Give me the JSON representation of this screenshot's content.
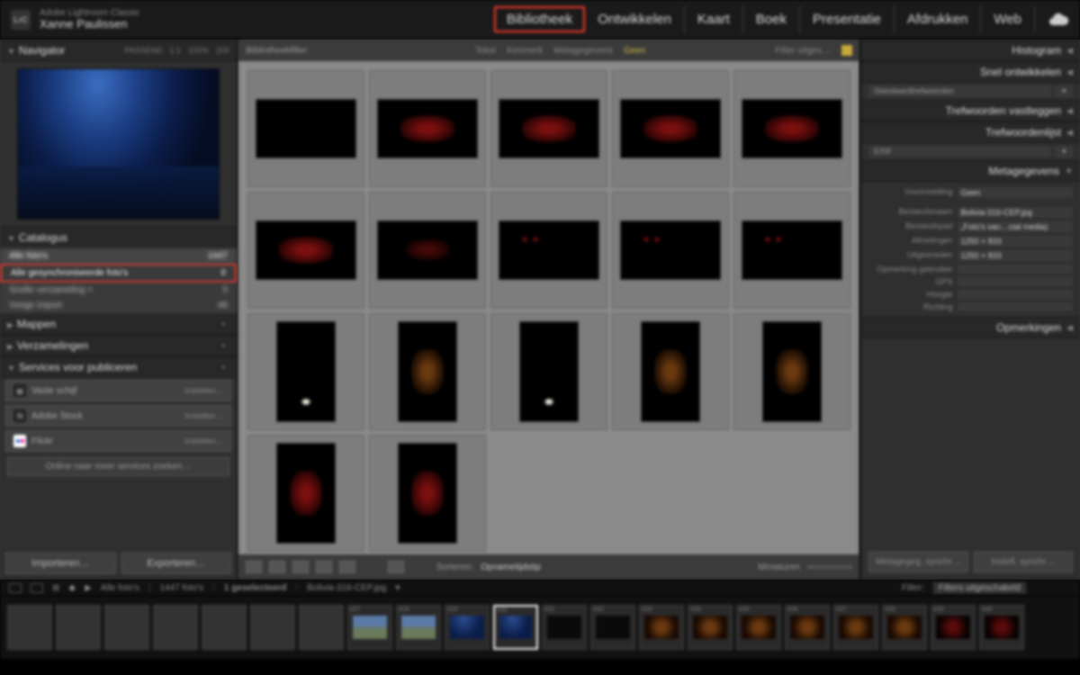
{
  "app": {
    "product": "Adobe Lightroom Classic",
    "user": "Xanne Paulissen",
    "logo": "LrC"
  },
  "modules": [
    "Bibliotheek",
    "Ontwikkelen",
    "Kaart",
    "Boek",
    "Presentatie",
    "Afdrukken",
    "Web"
  ],
  "active_module": "Bibliotheek",
  "navigator": {
    "title": "Navigator",
    "modes": [
      "PASSEND",
      "1:1",
      "100%",
      "200"
    ]
  },
  "catalog": {
    "title": "Catalogus",
    "rows": [
      {
        "label": "Alle foto's",
        "count": "1447"
      },
      {
        "label": "Alle gesynchroniseerde foto's",
        "count": "0",
        "highlight": true
      },
      {
        "label": "Snelle verzameling  +",
        "count": "5"
      },
      {
        "label": "Vorige import",
        "count": "48"
      }
    ]
  },
  "folders": {
    "title": "Mappen"
  },
  "collections": {
    "title": "Verzamelingen"
  },
  "publish": {
    "title": "Services voor publiceren",
    "rows": [
      {
        "icon": "hdd",
        "label": "Vaste schijf",
        "action": "Instellen…"
      },
      {
        "icon": "St",
        "label": "Adobe Stock",
        "action": "Instellen…"
      },
      {
        "icon": "flk",
        "label": "Flickr",
        "action": "Instellen…"
      }
    ],
    "online": "Online naar meer services zoeken…"
  },
  "buttons": {
    "import": "Importeren…",
    "export": "Exporteren…"
  },
  "filter_bar": {
    "title": "Bibliotheekfilter:",
    "tabs": [
      "Tekst",
      "Kenmerk",
      "Metagegevens"
    ],
    "none": "Geen",
    "preset": "Filter uitges…"
  },
  "grid": {
    "rows": [
      [
        "wide-empty",
        "wide-red",
        "wide-red",
        "wide-red",
        "wide-red"
      ],
      [
        "wide-red",
        "wide-reddim",
        "wide-reddots",
        "wide-reddots",
        "wide-reddots"
      ],
      [
        "tall-light",
        "tall-orange",
        "tall-light",
        "tall-orange",
        "tall-orange"
      ],
      [
        "tall-red",
        "tall-red",
        "",
        "",
        ""
      ]
    ]
  },
  "toolbar": {
    "sort_label": "Sorteren:",
    "sort_value": "Opnametijdstip",
    "thumb_label": "Miniaturen"
  },
  "right": {
    "panels": [
      "Histogram",
      "Snel ontwikkelen",
      "Trefwoorden vastleggen",
      "Trefwoordenlijst",
      "Metagegevens",
      "Opmerkingen"
    ],
    "preset1": "Standaardtrefwoorden",
    "preset2": "EXIF",
    "meta_preset_label": "Voorinstelling",
    "meta_preset_value": "Geen",
    "meta": [
      {
        "k": "Bestandsnaam",
        "v": "Bolivia-316-CEP.jpg"
      },
      {
        "k": "Bestandspad",
        "v": "„Foto's van…cial media)"
      },
      {
        "k": "Afmetingen",
        "v": "1250 × 833"
      },
      {
        "k": "Uitgesneden",
        "v": "1250 × 833"
      },
      {
        "k": "Opmerking gebruiker",
        "v": ""
      },
      {
        "k": "GPS",
        "v": ""
      },
      {
        "k": "Hoogte",
        "v": ""
      },
      {
        "k": "Richting",
        "v": ""
      }
    ],
    "btn1": "Metagegeg. synchr…",
    "btn2": "Instell. synchr…"
  },
  "status": {
    "path": "Alle foto's",
    "count": "1447 foto's",
    "sel": "1 geselecteerd",
    "file": "Bolivia-316-CEP.jpg",
    "filter_label": "Filter:",
    "filter_value": "Filters uitgeschakeld"
  },
  "filmstrip": {
    "selected_index": 10,
    "items": [
      "blank",
      "blank",
      "blank",
      "blank",
      "blank",
      "blank",
      "blank",
      "city",
      "city",
      "milky",
      "milky",
      "dark",
      "dark",
      "orange",
      "orange",
      "orange",
      "orange",
      "orange",
      "orange",
      "red",
      "red"
    ]
  }
}
